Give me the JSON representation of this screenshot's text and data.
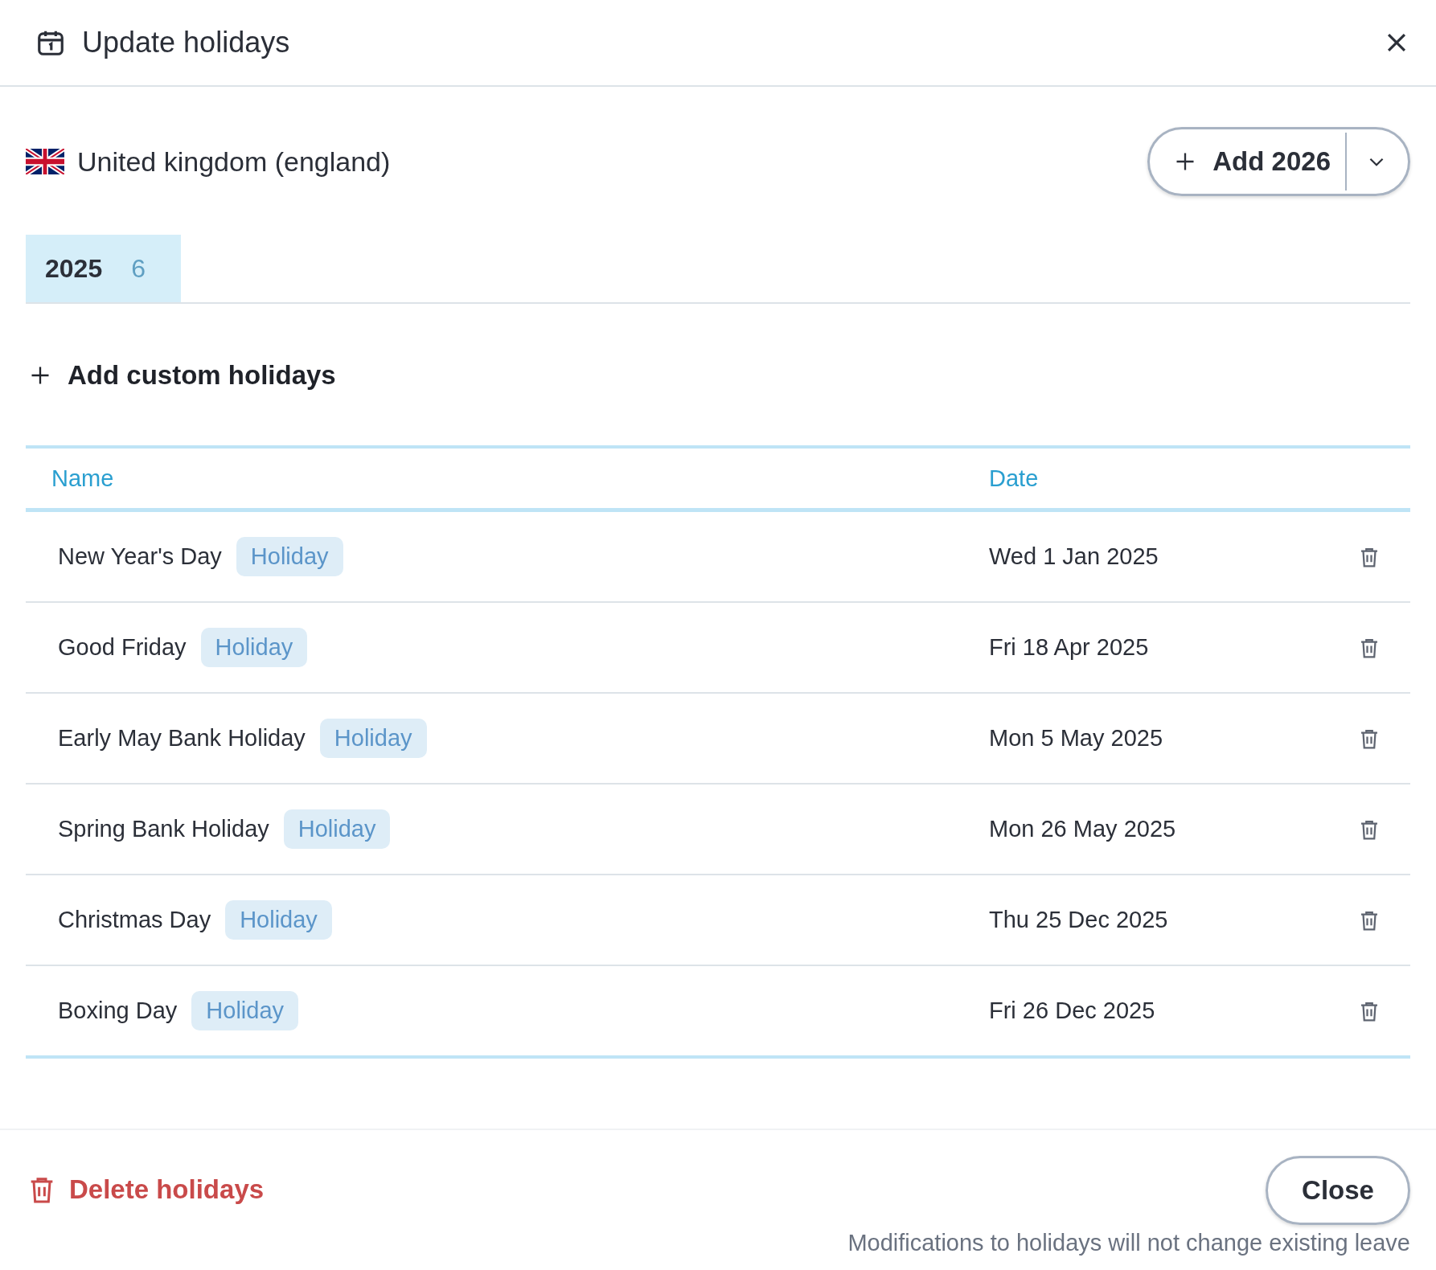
{
  "window": {
    "title": "Update holidays"
  },
  "country": {
    "name": "United kingdom (england)"
  },
  "add_year_button": {
    "label": "Add 2026"
  },
  "tabs": [
    {
      "label": "2025",
      "count": "6",
      "selected": true
    }
  ],
  "add_custom_link": {
    "label": "Add custom holidays"
  },
  "table": {
    "columns": [
      "Name",
      "Date"
    ],
    "rows": [
      {
        "name": "New Year's Day",
        "tag": "Holiday",
        "date": "Wed 1 Jan 2025"
      },
      {
        "name": "Good Friday",
        "tag": "Holiday",
        "date": "Fri 18 Apr 2025"
      },
      {
        "name": "Early May Bank Holiday",
        "tag": "Holiday",
        "date": "Mon 5 May 2025"
      },
      {
        "name": "Spring Bank Holiday",
        "tag": "Holiday",
        "date": "Mon 26 May 2025"
      },
      {
        "name": "Christmas Day",
        "tag": "Holiday",
        "date": "Thu 25 Dec 2025"
      },
      {
        "name": "Boxing Day",
        "tag": "Holiday",
        "date": "Fri 26 Dec 2025"
      }
    ]
  },
  "footer": {
    "delete_label": "Delete holidays",
    "close_label": "Close",
    "note": "Modifications to holidays will not change existing leave"
  }
}
